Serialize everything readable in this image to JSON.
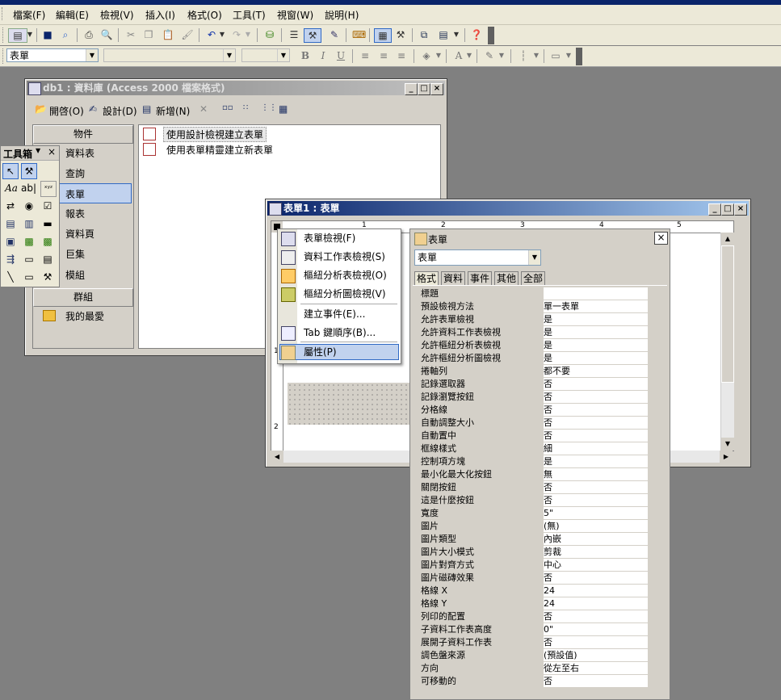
{
  "menubar": {
    "items": [
      "檔案(F)",
      "編輯(E)",
      "檢視(V)",
      "插入(I)",
      "格式(O)",
      "工具(T)",
      "視窗(W)",
      "說明(H)"
    ]
  },
  "format_toolbar": {
    "object_combo": "表單",
    "bold": "B",
    "italic": "I",
    "underline": "U",
    "font_color": "A"
  },
  "db_window": {
    "title": "db1 : 資料庫 (Access 2000 檔案格式)",
    "toolbar": {
      "open": "開啓(O)",
      "design": "設計(D)",
      "new": "新增(N)"
    },
    "objects_header": "物件",
    "objects": [
      "資料表",
      "查詢",
      "表單",
      "報表",
      "資料頁",
      "巨集",
      "模組"
    ],
    "groups_header": "群組",
    "favorites": "我的最愛",
    "list": [
      "使用設計檢視建立表單",
      "使用表單精靈建立新表單"
    ]
  },
  "toolbox": {
    "title": "工具箱",
    "label_tool": "Aa",
    "textbox_tool": "ab|"
  },
  "form_window": {
    "title": "表單1 : 表單",
    "ruler_marks": [
      "1",
      "2",
      "3",
      "4",
      "5"
    ],
    "vruler_marks": [
      "1",
      "2"
    ]
  },
  "context_menu": {
    "items": [
      "表單檢視(F)",
      "資料工作表檢視(S)",
      "樞紐分析表檢視(O)",
      "樞紐分析圖檢視(V)",
      "建立事件(E)...",
      "Tab 鍵順序(B)...",
      "屬性(P)"
    ]
  },
  "property_sheet": {
    "title": "表單",
    "selector": "表單",
    "tabs": [
      "格式",
      "資料",
      "事件",
      "其他",
      "全部"
    ],
    "rows": [
      {
        "label": "標題",
        "value": ""
      },
      {
        "label": "預設檢視方法",
        "value": "單一表單"
      },
      {
        "label": "允許表單檢視",
        "value": "是"
      },
      {
        "label": "允許資料工作表檢視",
        "value": "是"
      },
      {
        "label": "允許樞紐分析表檢視",
        "value": "是"
      },
      {
        "label": "允許樞紐分析圖檢視",
        "value": "是"
      },
      {
        "label": "捲軸列",
        "value": "都不要"
      },
      {
        "label": "記錄選取器",
        "value": "否"
      },
      {
        "label": "記錄瀏覽按鈕",
        "value": "否"
      },
      {
        "label": "分格線",
        "value": "否"
      },
      {
        "label": "自動調整大小",
        "value": "否"
      },
      {
        "label": "自動置中",
        "value": "否"
      },
      {
        "label": "框線樣式",
        "value": "細"
      },
      {
        "label": "控制項方塊",
        "value": "是"
      },
      {
        "label": "最小化最大化按鈕",
        "value": "無"
      },
      {
        "label": "關閉按鈕",
        "value": "否"
      },
      {
        "label": "這是什麼按鈕",
        "value": "否"
      },
      {
        "label": "寬度",
        "value": "5\""
      },
      {
        "label": "圖片",
        "value": "(無)"
      },
      {
        "label": "圖片類型",
        "value": "內嵌"
      },
      {
        "label": "圖片大小模式",
        "value": "剪裁"
      },
      {
        "label": "圖片對齊方式",
        "value": "中心"
      },
      {
        "label": "圖片磁磚效果",
        "value": "否"
      },
      {
        "label": "格線 X",
        "value": "24"
      },
      {
        "label": "格線 Y",
        "value": "24"
      },
      {
        "label": "列印的配置",
        "value": "否"
      },
      {
        "label": "子資料工作表高度",
        "value": "0\""
      },
      {
        "label": "展開子資料工作表",
        "value": "否"
      },
      {
        "label": "調色盤來源",
        "value": "(預設值)"
      },
      {
        "label": "方向",
        "value": "從左至右"
      },
      {
        "label": "可移動的",
        "value": "否"
      }
    ]
  }
}
